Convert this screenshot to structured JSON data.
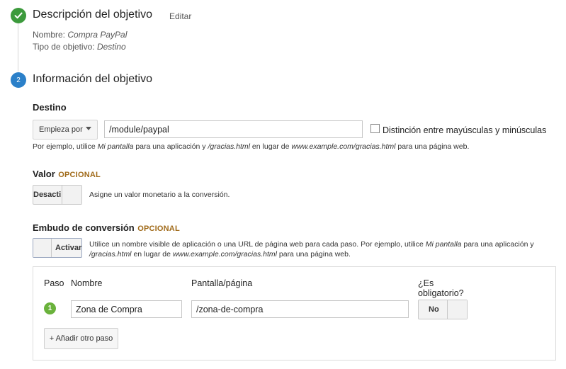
{
  "step1": {
    "title": "Descripción del objetivo",
    "edit_label": "Editar",
    "name_label": "Nombre:",
    "name_value": "Compra PayPal",
    "type_label": "Tipo de objetivo:",
    "type_value": "Destino"
  },
  "step2": {
    "number": "2",
    "title": "Información del objetivo"
  },
  "destination": {
    "label": "Destino",
    "match_type": "Empieza por",
    "value": "/module/paypal",
    "case_label": "Distinción entre mayúsculas y minúsculas",
    "hint": {
      "p1": "Por ejemplo, utilice ",
      "i1": "Mi pantalla",
      "p2": " para una aplicación y ",
      "i2": "/gracias.html",
      "p3": " en lugar de ",
      "i3": "www.example.com/gracias.html",
      "p4": " para una página web."
    }
  },
  "value": {
    "label": "Valor",
    "optional": "OPCIONAL",
    "toggle_label": "Desacti",
    "hint": "Asigne un valor monetario a la conversión."
  },
  "funnel": {
    "label": "Embudo de conversión",
    "optional": "OPCIONAL",
    "toggle_label": "Activar",
    "hint": {
      "p1": "Utilice un nombre visible de aplicación o una URL de página web para cada paso. Por ejemplo, utilice ",
      "i1": "Mi pantalla",
      "p2": " para una aplicación y",
      "i2": "/gracias.html",
      "p3": " en lugar de ",
      "i3": "www.example.com/gracias.html",
      "p4": " para una página web."
    },
    "columns": {
      "step": "Paso",
      "name": "Nombre",
      "screen": "Pantalla/página",
      "required_line1": "¿Es",
      "required_line2": "obligatorio?"
    },
    "rows": [
      {
        "step": "1",
        "name": "Zona de Compra",
        "screen": "/zona-de-compra",
        "required": "No"
      }
    ],
    "add_button": "+ Añadir otro paso"
  },
  "colors": {
    "done": "#3c9a3c",
    "active_step": "#2b80c9",
    "optional": "#a06a19",
    "funnel_step": "#6ab23c"
  }
}
